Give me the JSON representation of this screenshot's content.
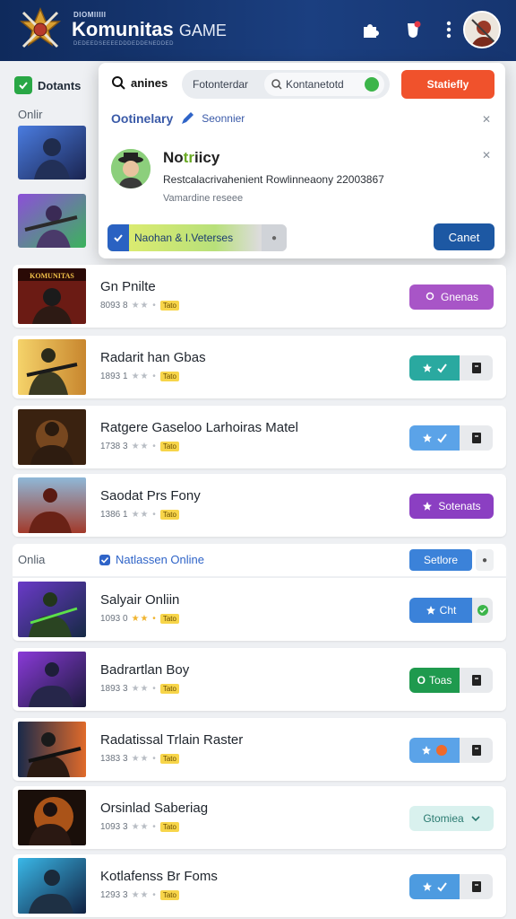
{
  "header": {
    "brand_small": "DIOMIIIII",
    "brand_main": "Komunitas",
    "brand_suffix": "GAME",
    "brand_sub": "DEDEEDSEEEEDDDEDDENEDDED",
    "icons": [
      "puzzle-icon",
      "notification-icon",
      "more-icon"
    ]
  },
  "sidebar": {
    "filter_label": "Dotants",
    "online_label": "Onlir"
  },
  "popup": {
    "search_label": "anines",
    "tab1": "Fotonterdar",
    "tab2": "Kontanetotd",
    "action_button": "Statiefly",
    "heading": "Ootinelary",
    "subheading": "Seonnier",
    "user_name_prefix": "No",
    "user_name_highlight": "tr",
    "user_name_suffix": "iicy",
    "description": "Restcalacrivahenient Rowlinneaony 22003867",
    "description2": "Vamardine reseee",
    "chip_text": "Naohan  &  I.Veterses",
    "cancel_button": "Canet"
  },
  "games": [
    {
      "title": "Gn Pnilte",
      "rating": "8093 8",
      "tag": "Tato",
      "button": "Gnenas",
      "color": "#a855c7"
    },
    {
      "title": "Radarit han Gbas",
      "rating": "1893 1",
      "tag": "Tato",
      "button": "",
      "color": "#2aa9a0"
    },
    {
      "title": "Ratgere Gaseloo Larhoiras Matel",
      "rating": "1738 3",
      "tag": "Tato",
      "button": "",
      "color": "#4d9be0"
    },
    {
      "title": "Saodat Prs Fony",
      "rating": "1386 1",
      "tag": "Tato",
      "button": "Sotenats",
      "color": "#8b3fc2"
    }
  ],
  "section": {
    "left": "Onlia",
    "mid": "Natlassen Online",
    "button": "Setlore"
  },
  "games2": [
    {
      "title": "Salyair Onliin",
      "rating": "1093 0",
      "tag": "Tato",
      "button": "Cht",
      "color": "#3b82d9"
    },
    {
      "title": "Badrartlan Boy",
      "rating": "1893 3",
      "tag": "Tato",
      "button": "Toas",
      "color": "#1f9a4e"
    },
    {
      "title": "Radatissal Trlain Raster",
      "rating": "1383 3",
      "tag": "Tato",
      "button": "",
      "color": "#5ba3e8"
    },
    {
      "title": "Orsinlad Saberiag",
      "rating": "1093 3",
      "tag": "Tato",
      "button": "Gtomiea",
      "color": "#d9f1ee"
    },
    {
      "title": "Kotlafenss Br Foms",
      "rating": "1293 3",
      "tag": "Tato",
      "button": "",
      "color": "#4d9be0"
    }
  ]
}
